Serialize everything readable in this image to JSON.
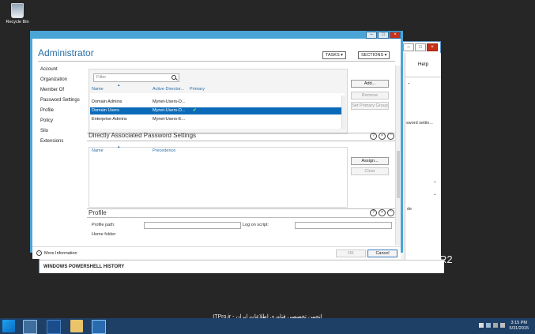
{
  "desktop": {
    "recycle_bin_label": "Recycle Bin",
    "watermark": "ITPro.ir - انجمن تخصصی فناوری اطلاعات ایران",
    "partial_os_text": "R2"
  },
  "bg_window": {
    "help_label": "Help",
    "right_text_1": "sword settin...",
    "right_text_2": "de",
    "powershell_history": "WINDOWS POWERSHELL HISTORY"
  },
  "dialog": {
    "title": "Administrator",
    "tasks_button": "TASKS",
    "sections_button": "SECTIONS",
    "nav_items": [
      {
        "label": "Account"
      },
      {
        "label": "Organization"
      },
      {
        "label": "Member Of"
      },
      {
        "label": "Password Settings"
      },
      {
        "label": "Profile"
      },
      {
        "label": "Policy"
      },
      {
        "label": "Silo"
      },
      {
        "label": "Extensions"
      }
    ],
    "member_of": {
      "filter_placeholder": "Filter",
      "columns": [
        "Name",
        "Active Director...",
        "Primary"
      ],
      "rows": [
        {
          "name": "Domain Admins",
          "path": "Mynet-Users-D...",
          "primary": ""
        },
        {
          "name": "Domain Users",
          "path": "Mynet-Users-D...",
          "primary": "✔"
        },
        {
          "name": "Enterprise Admins",
          "path": "Mynet-Users-E...",
          "primary": ""
        }
      ],
      "add_button": "Add...",
      "remove_button": "Remove",
      "set_primary_button": "Set Primary Group"
    },
    "password_settings": {
      "title": "Directly Associated Password Settings",
      "columns": [
        "Name",
        "Precedence"
      ],
      "assign_button": "Assign...",
      "clear_button": "Clear"
    },
    "profile": {
      "title": "Profile",
      "profile_path_label": "Profile path:",
      "logon_script_label": "Log on script:",
      "home_folder_label": "Home folder:"
    },
    "more_information": "More Information",
    "ok_button": "OK",
    "cancel_button": "Cancel"
  },
  "taskbar": {
    "time": "3:15 PM",
    "date": "5/31/2015"
  }
}
